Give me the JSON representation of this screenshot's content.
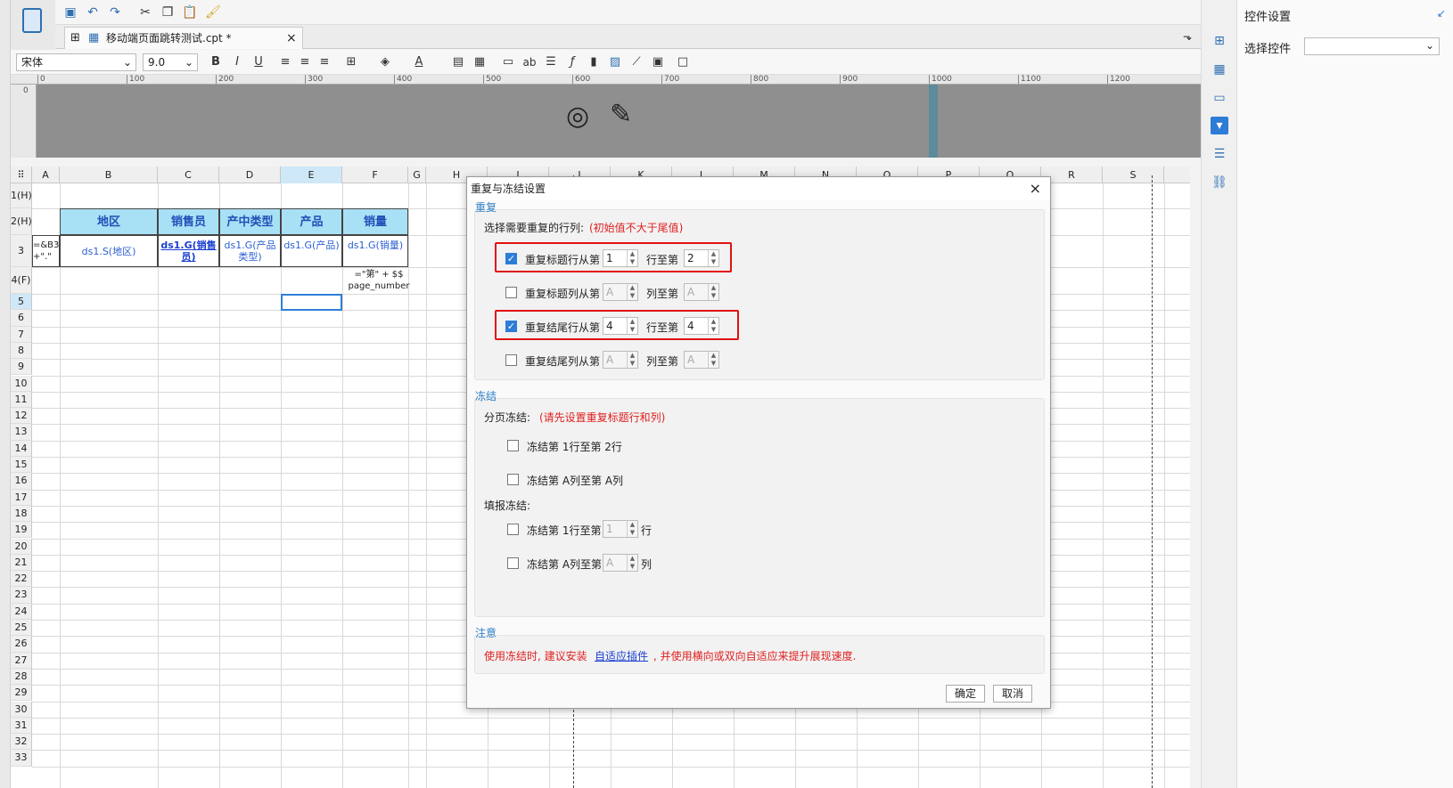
{
  "toolbar": {
    "icons": [
      "save-icon",
      "undo-icon",
      "redo-icon",
      "cut-icon",
      "copy-icon",
      "paste-icon",
      "format-brush-icon"
    ]
  },
  "tab": {
    "title": "移动端页面跳转测试.cpt *",
    "close": "×"
  },
  "format_bar": {
    "font": "宋体",
    "size": "9.0",
    "bold": "B",
    "italic": "I",
    "underline": "U",
    "text_icon": "ab"
  },
  "ruler": {
    "marks": [
      "0",
      "100",
      "200",
      "300",
      "400",
      "500",
      "600",
      "700",
      "800",
      "900",
      "1000",
      "1100",
      "1200"
    ],
    "v_zero": "0"
  },
  "sheet": {
    "columns": [
      "A",
      "B",
      "C",
      "D",
      "E",
      "F",
      "G",
      "H",
      "I",
      "J",
      "K",
      "L",
      "M",
      "N",
      "O",
      "P",
      "Q",
      "R",
      "S"
    ],
    "rows": [
      "1(H)",
      "2(H)",
      "3",
      "4(F)",
      "5",
      "6",
      "7",
      "8",
      "9",
      "10",
      "11",
      "12",
      "13",
      "14",
      "15",
      "16",
      "17",
      "18",
      "19",
      "20",
      "21",
      "22",
      "23",
      "24",
      "25",
      "26",
      "27",
      "28",
      "29",
      "30",
      "31",
      "32",
      "33"
    ],
    "headers": [
      "地区",
      "销售员",
      "产中类型",
      "产品",
      "销量"
    ],
    "row3": {
      "a": "=&B3 +\".\"",
      "b": "ds1.S(地区)",
      "c": "ds1.G(销售员)",
      "d": "ds1.G(产品类型)",
      "e": "ds1.G(产品)",
      "f": "ds1.G(销量)"
    },
    "footer": "=\"第\" + $$ page_number"
  },
  "right_panel": {
    "title": "控件设置",
    "select_label": "选择控件"
  },
  "dialog": {
    "title": "重复与冻结设置",
    "repeat": {
      "section": "重复",
      "prompt": "选择需要重复的行列:",
      "hint": "(初始值不大于尾值)",
      "rows": [
        {
          "label": "重复标题行从第",
          "to": "行至第",
          "from_val": "1",
          "to_val": "2",
          "checked": true
        },
        {
          "label": "重复标题列从第",
          "to": "列至第",
          "from_val": "A",
          "to_val": "A",
          "checked": false
        },
        {
          "label": "重复结尾行从第",
          "to": "行至第",
          "from_val": "4",
          "to_val": "4",
          "checked": true
        },
        {
          "label": "重复结尾列从第",
          "to": "列至第",
          "from_val": "A",
          "to_val": "A",
          "checked": false
        }
      ]
    },
    "freeze": {
      "section": "冻结",
      "page_label": "分页冻结:",
      "page_hint": "(请先设置重复标题行和列)",
      "page_row": "冻结第  1行至第 2行",
      "page_col": "冻结第  A列至第  A列",
      "fill_label": "填报冻结:",
      "fill_row": "冻结第  1行至第",
      "fill_row_val": "1",
      "fill_row_unit": "行",
      "fill_col": "冻结第  A列至第",
      "fill_col_val": "A",
      "fill_col_unit": "列"
    },
    "note": {
      "section": "注意",
      "text1": "使用冻结时, 建议安装",
      "link": "自适应插件",
      "text2": ", 并使用横向或双向自适应来提升展现速度."
    },
    "ok": "确定",
    "cancel": "取消",
    "close": "×"
  },
  "colors": {
    "accent": "#2d7cd6",
    "header_fill": "#a8e1f5",
    "red": "#e02020"
  }
}
